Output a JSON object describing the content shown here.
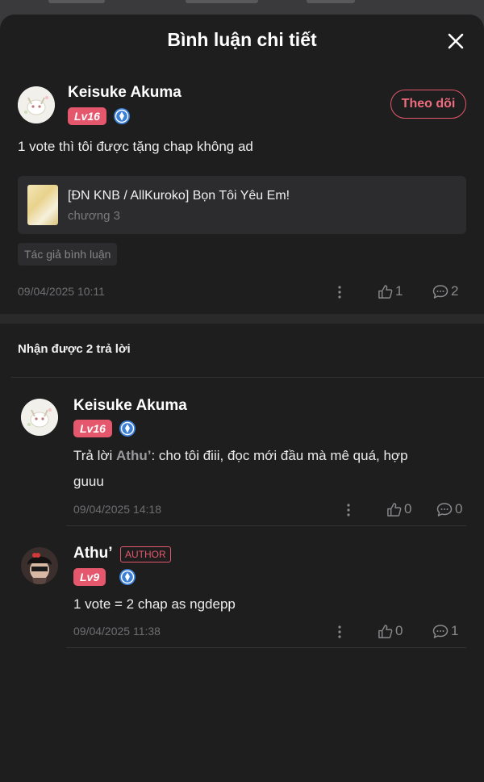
{
  "sheet": {
    "title": "Bình luận chi tiết"
  },
  "comment": {
    "user": "Keisuke Akuma",
    "level": "Lv16",
    "follow_label": "Theo dõi",
    "text": "1 vote thì tôi được tặng chap không ad",
    "story_title": "[ĐN KNB / AllKuroko] Bọn Tôi Yêu Em!",
    "story_chapter": "chương 3",
    "tag": "Tác giả bình luận",
    "timestamp": "09/04/2025 10:11",
    "likes": "1",
    "replies": "2"
  },
  "replies_header": "Nhận được 2 trả lời",
  "replies": [
    {
      "user": "Keisuke Akuma",
      "level": "Lv16",
      "prefix": "Trả lời ",
      "mention": "Athu’",
      "text_line1": ": cho tôi điii, đọc mới đầu mà mê quá, hợp",
      "text_line2": "guuu",
      "timestamp": "09/04/2025 14:18",
      "likes": "0",
      "replies": "0"
    },
    {
      "user": "Athu’",
      "badge": "AUTHOR",
      "level": "Lv9",
      "text": "1 vote = 2 chap as ngdepp",
      "timestamp": "09/04/2025 11:38",
      "likes": "0",
      "replies": "1"
    }
  ],
  "colors": {
    "accent": "#e5576c",
    "background": "#1e1e1f",
    "card": "#2c2c2e",
    "gem_blue": "#3b7fd6"
  }
}
